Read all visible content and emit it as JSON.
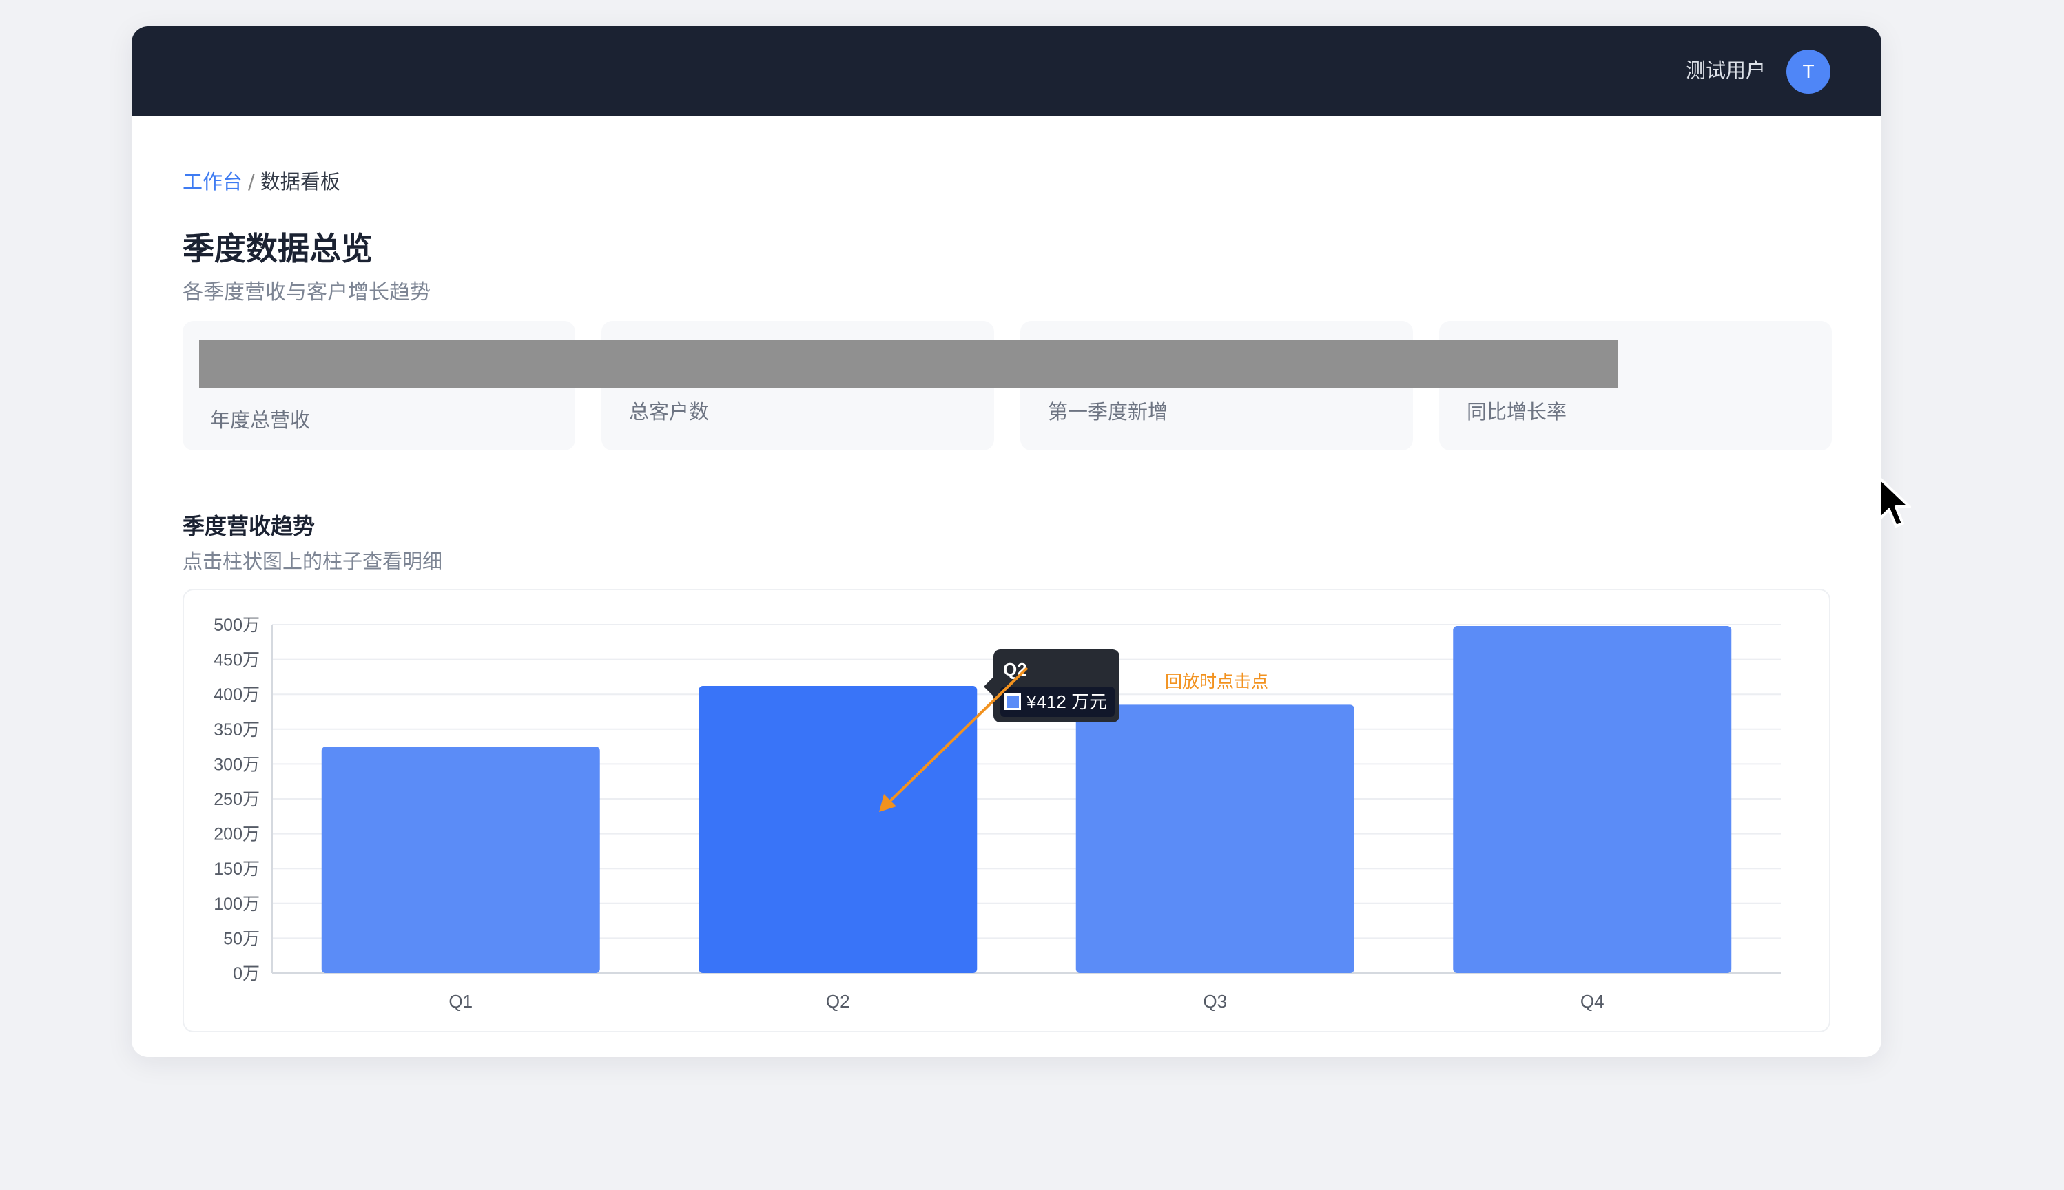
{
  "header": {
    "user_name": "测试用户",
    "avatar_initial": "T"
  },
  "breadcrumb": {
    "root": "工作台",
    "separator": "/",
    "current": "数据看板"
  },
  "page": {
    "title": "季度数据总览",
    "subtitle": "各季度营收与客户增长趋势"
  },
  "stats": [
    {
      "label": "年度总营收"
    },
    {
      "label": "总客户数"
    },
    {
      "label": "第一季度新增"
    },
    {
      "label": "同比增长率"
    }
  ],
  "section": {
    "title": "季度营收趋势",
    "subtitle": "点击柱状图上的柱子查看明细"
  },
  "chart_data": {
    "type": "bar",
    "categories": [
      "Q1",
      "Q2",
      "Q3",
      "Q4"
    ],
    "values": [
      325,
      412,
      385,
      498
    ],
    "ylim": [
      0,
      500
    ],
    "y_ticks": [
      "0万",
      "50万",
      "100万",
      "150万",
      "200万",
      "250万",
      "300万",
      "350万",
      "400万",
      "450万",
      "500万"
    ],
    "grid": true,
    "highlighted_category": "Q2",
    "bar_color": "#5b8cf7",
    "highlight_color": "#3974f8"
  },
  "tooltip": {
    "title": "Q2",
    "value": "¥412 万元"
  },
  "annotation": {
    "text": "回放时点击点",
    "color": "#f2921f"
  }
}
